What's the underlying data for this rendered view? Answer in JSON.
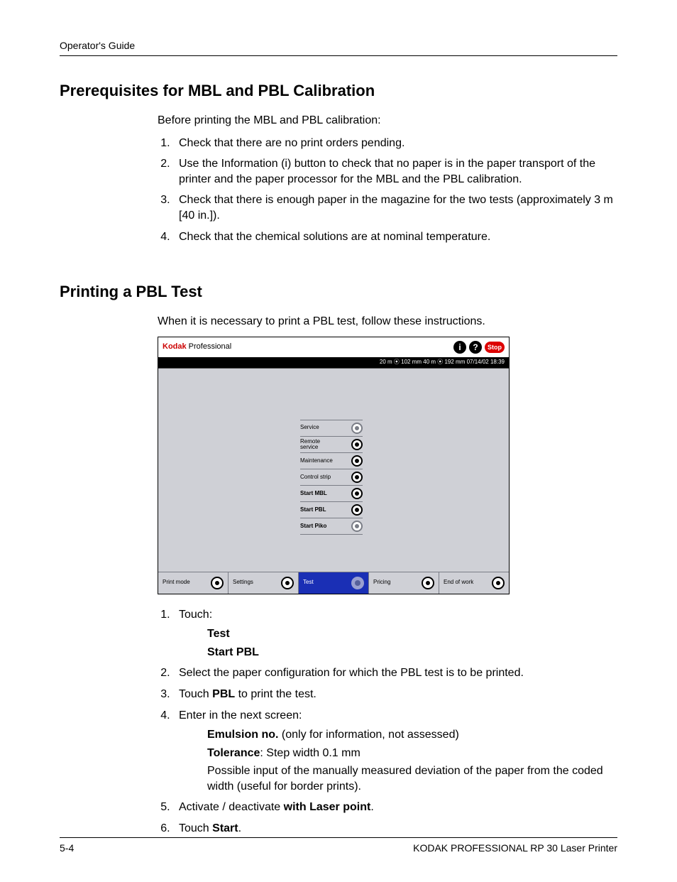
{
  "header": {
    "running_head": "Operator's Guide"
  },
  "section1": {
    "title": "Prerequisites for MBL and PBL Calibration",
    "intro": "Before printing the MBL and PBL calibration:",
    "steps": [
      "Check that there are no print orders pending.",
      "Use the Information (i) button to check that no paper is in the paper transport of the printer and the paper processor for the MBL and the PBL calibration.",
      "Check that there is enough paper in the magazine for the two tests (approximately 3 m [40 in.]).",
      "Check that the chemical solutions are at nominal temperature."
    ]
  },
  "section2": {
    "title": "Printing a PBL Test",
    "intro": "When it is necessary to print a PBL test, follow these instructions.",
    "device": {
      "brand_kodak": "Kodak",
      "brand_pro": " Professional",
      "stop_label": "Stop",
      "status_line": "20 m ⦿ 102 mm   40 m ⦿ 192 mm  07/14/02      18:39",
      "menu": [
        {
          "label": "Service",
          "bold": false,
          "active": false
        },
        {
          "label": "Remote service",
          "bold": false,
          "active": true
        },
        {
          "label": "Maintenance",
          "bold": false,
          "active": true
        },
        {
          "label": "Control strip",
          "bold": false,
          "active": true
        },
        {
          "label": "Start MBL",
          "bold": true,
          "active": true
        },
        {
          "label": "Start PBL",
          "bold": true,
          "active": true
        },
        {
          "label": "Start Piko",
          "bold": true,
          "active": false
        }
      ],
      "bottom": [
        {
          "label": "Print mode",
          "active": false
        },
        {
          "label": "Settings",
          "active": false
        },
        {
          "label": "Test",
          "active": true
        },
        {
          "label": "Pricing",
          "active": false
        },
        {
          "label": "End of work",
          "active": false
        }
      ]
    },
    "steps_after": {
      "s1_lead": "Touch:",
      "s1_sub1": "Test",
      "s1_sub2": "Start PBL",
      "s2": "Select the paper configuration for which the PBL test is to be printed.",
      "s3_pre": "Touch ",
      "s3_bold": "PBL",
      "s3_post": " to print the test.",
      "s4_lead": "Enter in the next screen:",
      "s4_em_bold": "Emulsion no.",
      "s4_em_rest": " (only for information, not assessed)",
      "s4_tol_bold": "Tolerance",
      "s4_tol_rest": ": Step width 0.1 mm",
      "s4_tol_note": "Possible input of the manually measured deviation of the paper from the coded width (useful for border prints).",
      "s5_pre": "Activate / deactivate ",
      "s5_bold": "with Laser point",
      "s5_post": ".",
      "s6_pre": "Touch ",
      "s6_bold": "Start",
      "s6_post": "."
    }
  },
  "footer": {
    "page": "5-4",
    "product": "KODAK PROFESSIONAL RP 30 Laser Printer"
  }
}
